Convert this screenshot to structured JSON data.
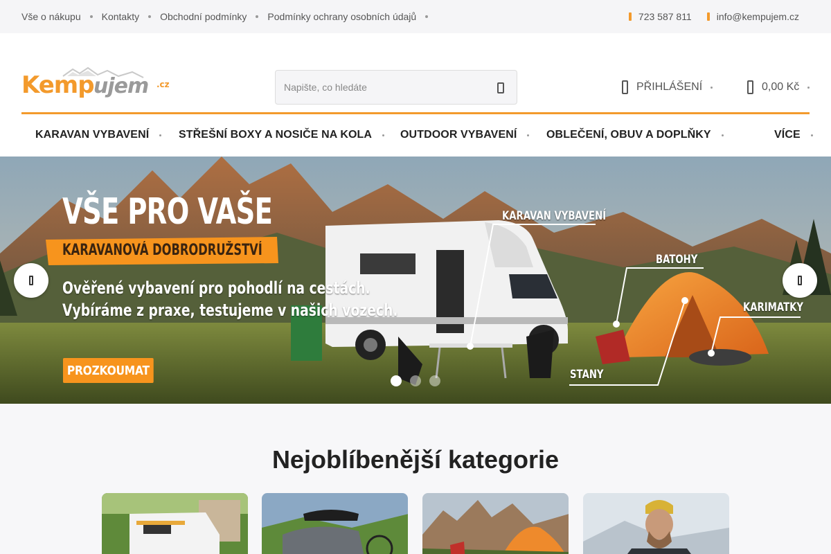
{
  "topbar": {
    "links": [
      "Vše o nákupu",
      "Kontakty",
      "Obchodní podmínky",
      "Podmínky ochrany osobních údajů"
    ],
    "phone": "723 587 811",
    "email": "info@kempujem.cz"
  },
  "header": {
    "logo_text": "Kempujem",
    "logo_suffix": ".cz",
    "search_placeholder": "Napište, co hledáte",
    "login_label": "PŘIHLÁŠENÍ",
    "cart_label": "0,00 Kč"
  },
  "nav": {
    "items": [
      "KARAVAN VYBAVENÍ",
      "STŘEŠNÍ BOXY A NOSIČE NA KOLA",
      "OUTDOOR VYBAVENÍ",
      "OBLEČENÍ, OBUV A DOPLŇKY",
      "VÍCE"
    ]
  },
  "banner": {
    "title": "VŠE PRO VAŠE",
    "subtitle": "KARAVANOVÁ DOBRODRUŽSTVÍ",
    "line1": "Ověřené vybavení pro pohodlí na cestách.",
    "line2": "Vybíráme z praxe, testujeme v našich vozech.",
    "cta": "PROZKOUMAT",
    "labels": [
      "KARAVAN VYBAVENÍ",
      "BATOHY",
      "KARIMATKY",
      "STANY"
    ],
    "slide_count": 3,
    "active_slide": 1
  },
  "categories": {
    "heading": "Nejoblíbenější kategorie"
  },
  "icons": {
    "phone": "phone-icon",
    "email": "email-icon",
    "search": "search-icon",
    "user": "user-icon",
    "cart": "cart-icon",
    "prev": "chevron-left-icon",
    "next": "chevron-right-icon"
  },
  "colors": {
    "accent": "#f39a2c",
    "cta": "#f7941d",
    "text": "#222222"
  }
}
